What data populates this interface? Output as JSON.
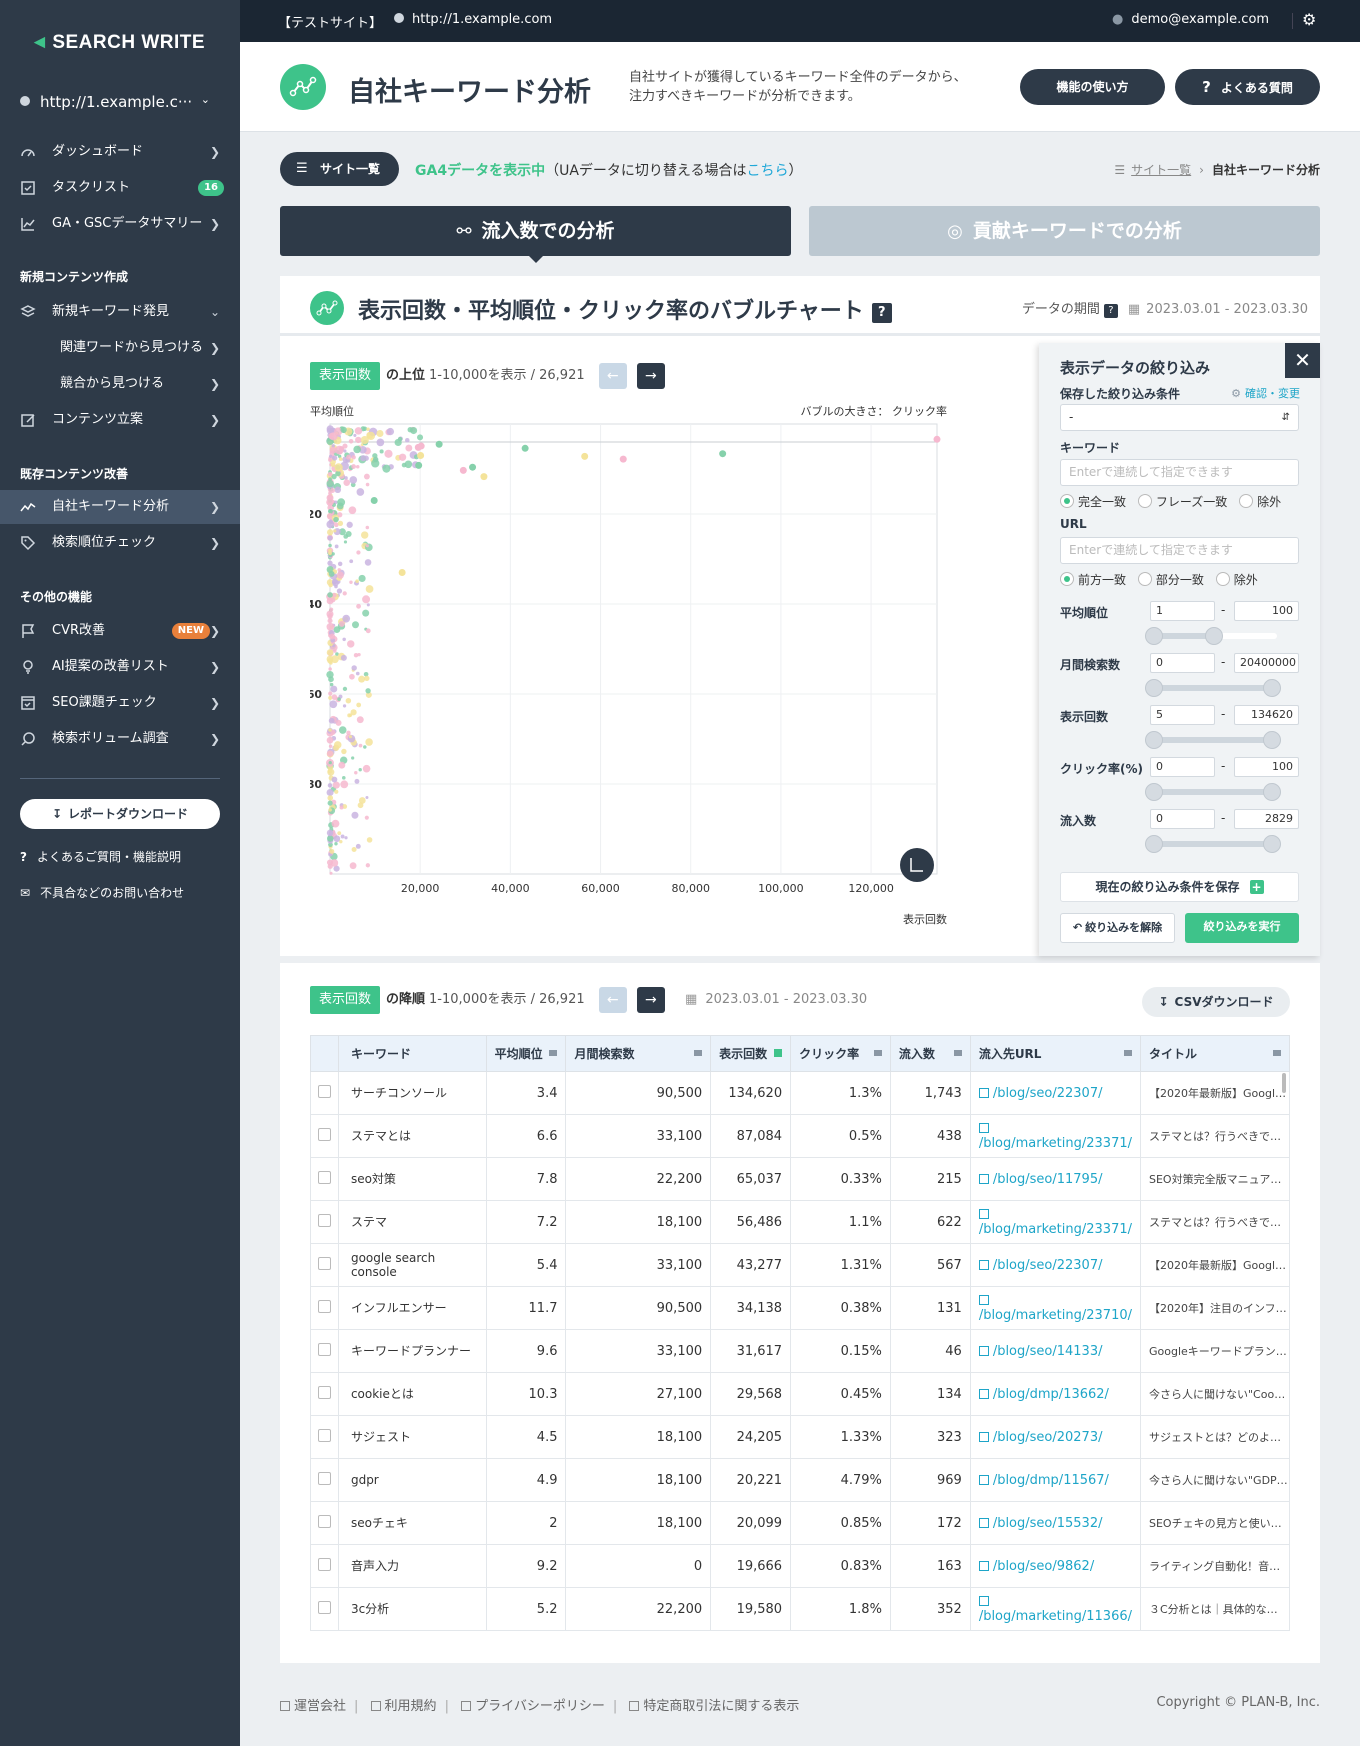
{
  "sidebar": {
    "logo": "SEARCH WRITE",
    "site": "http://1.example.c···",
    "items": [
      {
        "label": "ダッシュボード"
      },
      {
        "label": "タスクリスト",
        "badge": "16"
      },
      {
        "label": "GA・GSCデータサマリー"
      }
    ],
    "section_new": "新規コンテンツ作成",
    "new_items": [
      {
        "label": "新規キーワード発見"
      },
      {
        "label": "関連ワードから見つける"
      },
      {
        "label": "競合から見つける"
      },
      {
        "label": "コンテンツ立案"
      }
    ],
    "section_existing": "既存コンテンツ改善",
    "existing_items": [
      {
        "label": "自社キーワード分析"
      },
      {
        "label": "検索順位チェック"
      }
    ],
    "section_other": "その他の機能",
    "other_items": [
      {
        "label": "CVR改善",
        "badge": "NEW"
      },
      {
        "label": "AI提案の改善リスト"
      },
      {
        "label": "SEO課題チェック"
      },
      {
        "label": "検索ボリューム調査"
      }
    ],
    "report_btn": "レポートダウンロード",
    "faq_link": "よくあるご質問・機能説明",
    "contact_link": "不具合などのお問い合わせ"
  },
  "topbar": {
    "site_label": "【テストサイト】",
    "url": "http://1.example.com",
    "user": "demo@example.com"
  },
  "header": {
    "title": "自社キーワード分析",
    "desc1": "自社サイトが獲得しているキーワード全件のデータから、",
    "desc2": "注力すべきキーワードが分析できます。",
    "howto_btn": "機能の使い方",
    "faq_btn": "よくある質問"
  },
  "subbar": {
    "list_btn": "サイト一覧",
    "ga_note": "GA4データを表示中",
    "ga_note_rest": "（UAデータに切り替える場合は",
    "ga_link": "こちら",
    "ga_close": "）",
    "bc_link": "サイト一覧",
    "bc_current": "自社キーワード分析"
  },
  "tabs": {
    "tab1": "流入数での分析",
    "tab2": "貢献キーワードでの分析"
  },
  "chart_card": {
    "title": "表示回数・平均順位・クリック率のバブルチャート",
    "period_label": "データの期間",
    "period": "2023.03.01 - 2023.03.30",
    "metric_tag": "表示回数",
    "top_label": "の上位",
    "range": "1-10,000を表示 / 26,921"
  },
  "chart_data": {
    "type": "scatter",
    "ylabel": "平均順位",
    "xlabel": "表示回数",
    "size_label": "バブルの大きさ： クリック率",
    "xlim": [
      0,
      134620
    ],
    "ylim": [
      100,
      0
    ],
    "xticks": [
      "20,000",
      "40,000",
      "60,000",
      "80,000",
      "100,000",
      "120,000"
    ],
    "yticks": [
      "20",
      "40",
      "60",
      "80"
    ],
    "points": [
      [
        134620,
        3.4,
        "#f6b8cf"
      ],
      [
        87084,
        6.6,
        "#86d1ab"
      ],
      [
        65037,
        7.8,
        "#f6b8cf"
      ],
      [
        56486,
        7.2,
        "#f4e39a"
      ],
      [
        43277,
        5.4,
        "#86d1ab"
      ],
      [
        34138,
        11.7,
        "#f4e39a"
      ],
      [
        31617,
        9.6,
        "#86d1ab"
      ],
      [
        29568,
        10.3,
        "#f6b8cf"
      ],
      [
        24205,
        4.5,
        "#86d1ab"
      ],
      [
        20221,
        4.9,
        "#f6b8cf"
      ],
      [
        20099,
        7.0,
        "#f4e39a"
      ],
      [
        19666,
        9.2,
        "#86d1ab"
      ],
      [
        19580,
        5.2,
        "#f6b8cf"
      ],
      [
        16000,
        33,
        "#f4e39a"
      ],
      [
        9800,
        17,
        "#86d1ab"
      ]
    ]
  },
  "filter": {
    "title": "表示データの絞り込み",
    "saved_label": "保存した絞り込み条件",
    "saved_link": "確認・変更",
    "saved_value": "-",
    "kw_label": "キーワード",
    "kw_placeholder": "Enterで連続して指定できます",
    "kw_opts": [
      "完全一致",
      "フレーズ一致",
      "除外"
    ],
    "url_label": "URL",
    "url_placeholder": "Enterで連続して指定できます",
    "url_opts": [
      "前方一致",
      "部分一致",
      "除外"
    ],
    "ranges": [
      {
        "label": "平均順位",
        "min": "1",
        "max": "100"
      },
      {
        "label": "月間検索数",
        "min": "0",
        "max": "20400000"
      },
      {
        "label": "表示回数",
        "min": "5",
        "max": "134620"
      },
      {
        "label": "クリック率(%)",
        "min": "0",
        "max": "100"
      },
      {
        "label": "流入数",
        "min": "0",
        "max": "2829"
      }
    ],
    "save_btn": "現在の絞り込み条件を保存",
    "clear_btn": "絞り込みを解除",
    "apply_btn": "絞り込みを実行"
  },
  "table_card": {
    "metric_tag": "表示回数",
    "order_label": "の降順",
    "range": "1-10,000を表示 / 26,921",
    "period": "2023.03.01 - 2023.03.30",
    "csv_btn": "CSVダウンロード",
    "columns": [
      "キーワード",
      "平均順位",
      "月間検索数",
      "表示回数",
      "クリック率",
      "流入数",
      "流入先URL",
      "タイトル"
    ],
    "rows": [
      {
        "kw": "サーチコンソール",
        "rank": "3.4",
        "vol": "90,500",
        "imp": "134,620",
        "ctr": "1.3%",
        "clicks": "1,743",
        "url": "/blog/seo/22307/",
        "title": "【2020年最新版】Googl…"
      },
      {
        "kw": "ステマとは",
        "rank": "6.6",
        "vol": "33,100",
        "imp": "87,084",
        "ctr": "0.5%",
        "clicks": "438",
        "url": "/blog/marketing/23371/",
        "title": "ステマとは？行うべきで…"
      },
      {
        "kw": "seo対策",
        "rank": "7.8",
        "vol": "22,200",
        "imp": "65,037",
        "ctr": "0.33%",
        "clicks": "215",
        "url": "/blog/seo/11795/",
        "title": "SEO対策完全版マニュア…"
      },
      {
        "kw": "ステマ",
        "rank": "7.2",
        "vol": "18,100",
        "imp": "56,486",
        "ctr": "1.1%",
        "clicks": "622",
        "url": "/blog/marketing/23371/",
        "title": "ステマとは？行うべきで…"
      },
      {
        "kw": "google search console",
        "rank": "5.4",
        "vol": "33,100",
        "imp": "43,277",
        "ctr": "1.31%",
        "clicks": "567",
        "url": "/blog/seo/22307/",
        "title": "【2020年最新版】Googl…"
      },
      {
        "kw": "インフルエンサー",
        "rank": "11.7",
        "vol": "90,500",
        "imp": "34,138",
        "ctr": "0.38%",
        "clicks": "131",
        "url": "/blog/marketing/23710/",
        "title": "【2020年】注目のインフ…"
      },
      {
        "kw": "キーワードプランナー",
        "rank": "9.6",
        "vol": "33,100",
        "imp": "31,617",
        "ctr": "0.15%",
        "clicks": "46",
        "url": "/blog/seo/14133/",
        "title": "Googleキーワードプラン…"
      },
      {
        "kw": "cookieとは",
        "rank": "10.3",
        "vol": "27,100",
        "imp": "29,568",
        "ctr": "0.45%",
        "clicks": "134",
        "url": "/blog/dmp/13662/",
        "title": "今さら人に聞けない\"Coo…"
      },
      {
        "kw": "サジェスト",
        "rank": "4.5",
        "vol": "18,100",
        "imp": "24,205",
        "ctr": "1.33%",
        "clicks": "323",
        "url": "/blog/seo/20273/",
        "title": "サジェストとは？どのよ…"
      },
      {
        "kw": "gdpr",
        "rank": "4.9",
        "vol": "18,100",
        "imp": "20,221",
        "ctr": "4.79%",
        "clicks": "969",
        "url": "/blog/dmp/11567/",
        "title": "今さら人に聞けない\"GDP…"
      },
      {
        "kw": "seoチェキ",
        "rank": "2",
        "vol": "18,100",
        "imp": "20,099",
        "ctr": "0.85%",
        "clicks": "172",
        "url": "/blog/seo/15532/",
        "title": "SEOチェキの見方と使い…"
      },
      {
        "kw": "音声入力",
        "rank": "9.2",
        "vol": "0",
        "imp": "19,666",
        "ctr": "0.83%",
        "clicks": "163",
        "url": "/blog/seo/9862/",
        "title": "ライティング自動化！音…"
      },
      {
        "kw": "3c分析",
        "rank": "5.2",
        "vol": "22,200",
        "imp": "19,580",
        "ctr": "1.8%",
        "clicks": "352",
        "url": "/blog/marketing/11366/",
        "title": "３C分析とは｜具体的な…"
      }
    ]
  },
  "footer": {
    "links": [
      "運営会社",
      "利用規約",
      "プライバシーポリシー",
      "特定商取引法に関する表示"
    ],
    "copyright": "Copyright © PLAN-B, Inc."
  }
}
